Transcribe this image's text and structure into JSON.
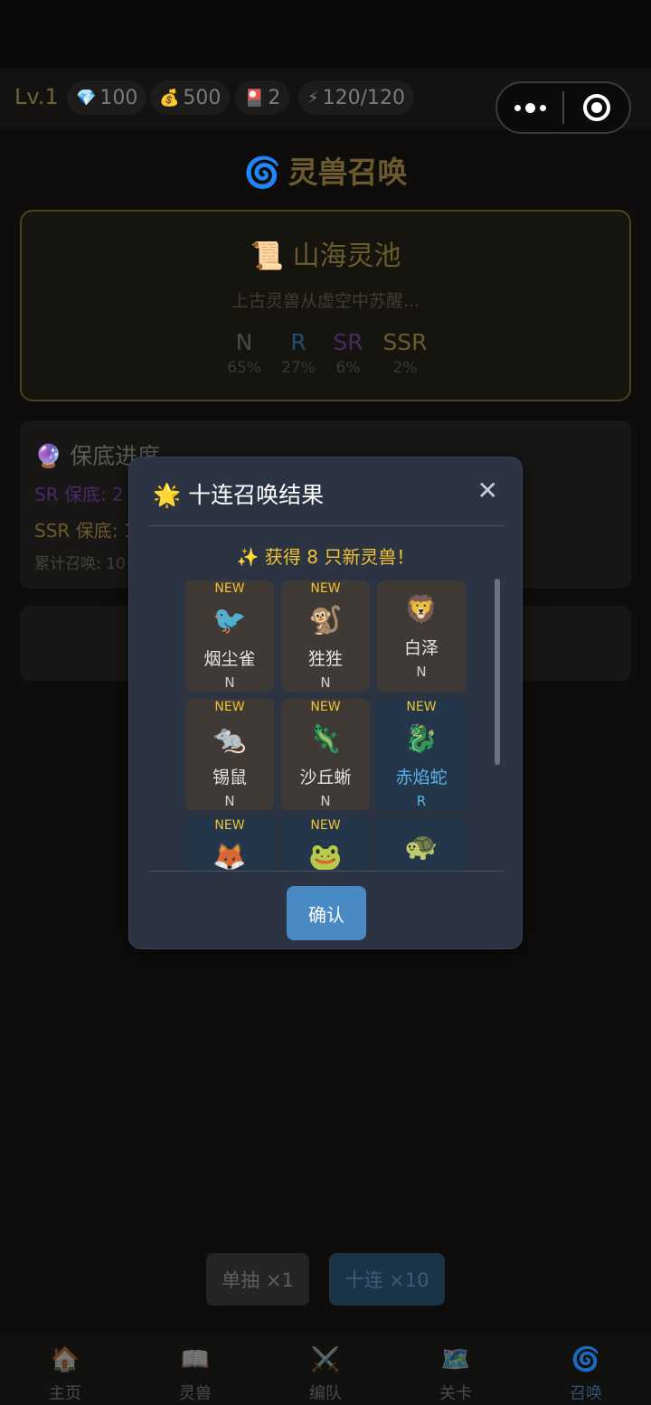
{
  "header": {
    "level": "Lv.1",
    "resources": [
      {
        "icon": "💎",
        "icon_name": "diamond-icon",
        "value": "100"
      },
      {
        "icon": "💰",
        "icon_name": "money-bag-icon",
        "value": "500"
      },
      {
        "icon": "🎴",
        "icon_name": "ticket-icon",
        "value": "2"
      },
      {
        "icon": "⚡",
        "icon_name": "energy-icon",
        "value": "120/120"
      }
    ]
  },
  "page": {
    "title": "灵兽召唤",
    "title_icon": "🌀"
  },
  "pool": {
    "icon": "📜",
    "title": "山海灵池",
    "subtitle": "上古灵兽从虚空中苏醒...",
    "rates": [
      {
        "rarity": "N",
        "percent": "65%",
        "color": "#4a4a4a"
      },
      {
        "rarity": "R",
        "percent": "27%",
        "color": "#1f4f70"
      },
      {
        "rarity": "SR",
        "percent": "6%",
        "color": "#4a2a5e"
      },
      {
        "rarity": "SSR",
        "percent": "2%",
        "color": "#6a5a2c"
      }
    ]
  },
  "pity": {
    "icon": "🔮",
    "title": "保底进度",
    "sr_label": "SR 保底: 2",
    "ssr_label": "SSR 保底: 1",
    "total_label": "累计召唤: 10"
  },
  "draw": {
    "single": "单抽 ×1",
    "ten": "十连 ×10"
  },
  "tabs": [
    {
      "icon": "🏠",
      "icon_name": "home-icon",
      "label": "主页",
      "active": false
    },
    {
      "icon": "📖",
      "icon_name": "book-icon",
      "label": "灵兽",
      "active": false
    },
    {
      "icon": "⚔️",
      "icon_name": "swords-icon",
      "label": "编队",
      "active": false
    },
    {
      "icon": "🗺️",
      "icon_name": "map-icon",
      "label": "关卡",
      "active": false
    },
    {
      "icon": "🌀",
      "icon_name": "swirl-icon",
      "label": "召唤",
      "active": true
    }
  ],
  "modal": {
    "icon": "🌟",
    "title": "十连召唤结果",
    "close": "✕",
    "summary": "✨ 获得 8 只新灵兽！",
    "confirm": "确认",
    "cards": [
      {
        "new": "NEW",
        "name": "烟尘雀",
        "rarity": "N",
        "sprite": "🐦",
        "tint": "#d8d8d8"
      },
      {
        "new": "NEW",
        "name": "狌狌",
        "rarity": "N",
        "sprite": "🐒",
        "tint": "#b08a5a"
      },
      {
        "new": "",
        "name": "白泽",
        "rarity": "N",
        "sprite": "🦁",
        "tint": "#e6e6e6"
      },
      {
        "new": "NEW",
        "name": "锡鼠",
        "rarity": "N",
        "sprite": "🐀",
        "tint": "#dcdcdc"
      },
      {
        "new": "NEW",
        "name": "沙丘蜥",
        "rarity": "N",
        "sprite": "🦎",
        "tint": "#d8c9a6"
      },
      {
        "new": "NEW",
        "name": "赤焰蛇",
        "rarity": "R",
        "sprite": "🐉",
        "tint": "#e06a3a"
      },
      {
        "new": "NEW",
        "name": "",
        "rarity": "",
        "sprite": "🦊",
        "tint": "#e8a040"
      },
      {
        "new": "NEW",
        "name": "",
        "rarity": "",
        "sprite": "🐸",
        "tint": "#9bd39b"
      },
      {
        "new": "",
        "name": "",
        "rarity": "",
        "sprite": "🐢",
        "tint": "#9bd39b"
      }
    ]
  }
}
